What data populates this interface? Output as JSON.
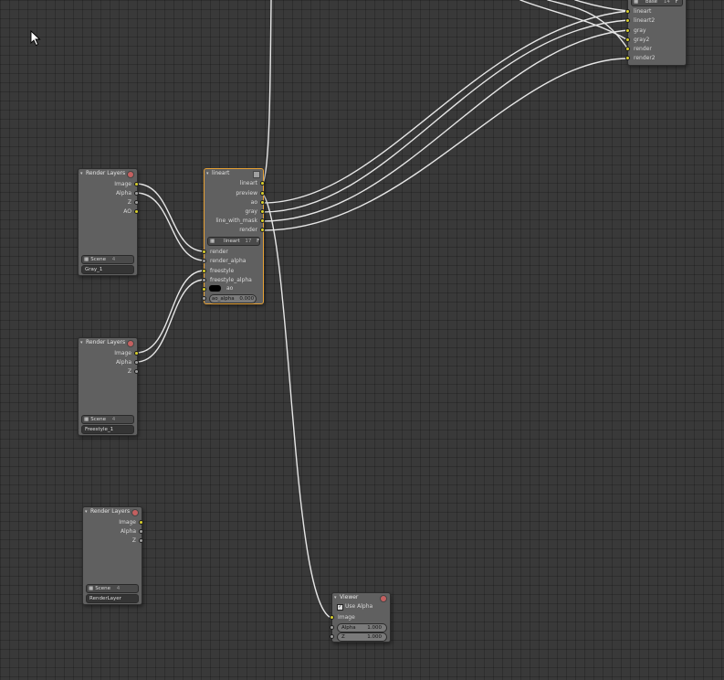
{
  "cursor": "arrow-cursor-icon",
  "nodes": {
    "rl1": {
      "title": "Render Layers",
      "outputs": [
        "Image",
        "Alpha",
        "Z",
        "AO"
      ],
      "scene": "Scene",
      "scene_count": "4",
      "layer": "Gray_1"
    },
    "rl2": {
      "title": "Render Layers",
      "outputs": [
        "Image",
        "Alpha",
        "Z"
      ],
      "scene": "Scene",
      "scene_count": "4",
      "layer": "Freestyle_1"
    },
    "rl3": {
      "title": "Render Layers",
      "outputs": [
        "Image",
        "Alpha",
        "Z"
      ],
      "scene": "Scene",
      "scene_count": "4",
      "layer": "RenderLayer"
    },
    "lineart": {
      "title": "lineart",
      "outputs": [
        "lineart",
        "preview",
        "ao",
        "gray",
        "line_with_mask",
        "render"
      ],
      "group": "lineart",
      "group_count": "17",
      "group_flag": "F",
      "inputs": [
        "render",
        "render_alpha",
        "freestyle",
        "freestyle_alpha"
      ],
      "ao_label": "ao",
      "ao_alpha_label": "ao_alpha",
      "ao_alpha_value": "0.000"
    },
    "viewer": {
      "title": "Viewer",
      "use_alpha": "Use Alpha",
      "image": "Image",
      "alpha_label": "Alpha",
      "alpha_value": "1.000",
      "z_label": "Z",
      "z_value": "1.000"
    },
    "top_right": {
      "base": "base",
      "count": "14",
      "flag": "F",
      "inputs": [
        "lineart",
        "lineart2",
        "gray",
        "gray2",
        "render",
        "render2"
      ]
    }
  },
  "colors": {
    "socket_color": "#d9d12e",
    "socket_value": "#a1a1a1",
    "active_border": "#e8a235",
    "link": "#e6e6e6"
  }
}
